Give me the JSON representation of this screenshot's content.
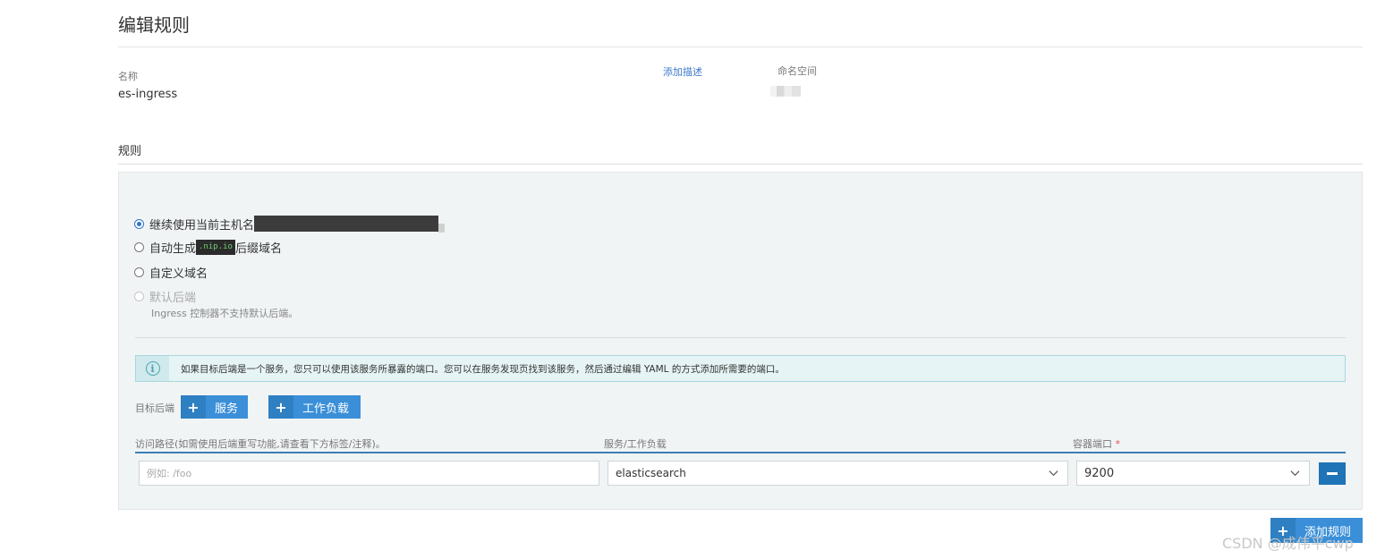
{
  "header": {
    "title": "编辑规则"
  },
  "meta": {
    "name_label": "名称",
    "name_value": "es-ingress",
    "add_description": "添加描述",
    "namespace_label": "命名空间"
  },
  "rules": {
    "section_title": "规则",
    "host_options": [
      {
        "label": "继续使用当前主机名",
        "checked": true,
        "disabled": false
      },
      {
        "label_prefix": "自动生成",
        "code": ".nip.io",
        "label_suffix": "后缀域名",
        "checked": false,
        "disabled": false
      },
      {
        "label": "自定义域名",
        "checked": false,
        "disabled": false
      },
      {
        "label": "默认后端",
        "checked": false,
        "disabled": true,
        "help": "Ingress 控制器不支持默认后端。"
      }
    ],
    "info_text": "如果目标后端是一个服务，您只可以使用该服务所暴露的端口。您可以在服务发现页找到该服务，然后通过编辑 YAML 的方式添加所需要的端口。",
    "target_label": "目标后端",
    "buttons": {
      "service": "服务",
      "workload": "工作负载",
      "add_rule": "添加规则"
    },
    "columns": {
      "path": "访问路径(如需使用后端重写功能,请查看下方标签/注释)。",
      "target": "服务/工作负载",
      "port": "容器端口",
      "port_required": "*"
    },
    "row": {
      "path_placeholder": "例如: /foo",
      "target_value": "elasticsearch",
      "port_value": "9200"
    }
  },
  "watermark": "CSDN @成伟平cwp",
  "colors": {
    "primary": "#3a8fd8",
    "link": "#3d78c8",
    "panel_bg": "#f1f4f5",
    "info_bg": "#e6f4f5"
  }
}
